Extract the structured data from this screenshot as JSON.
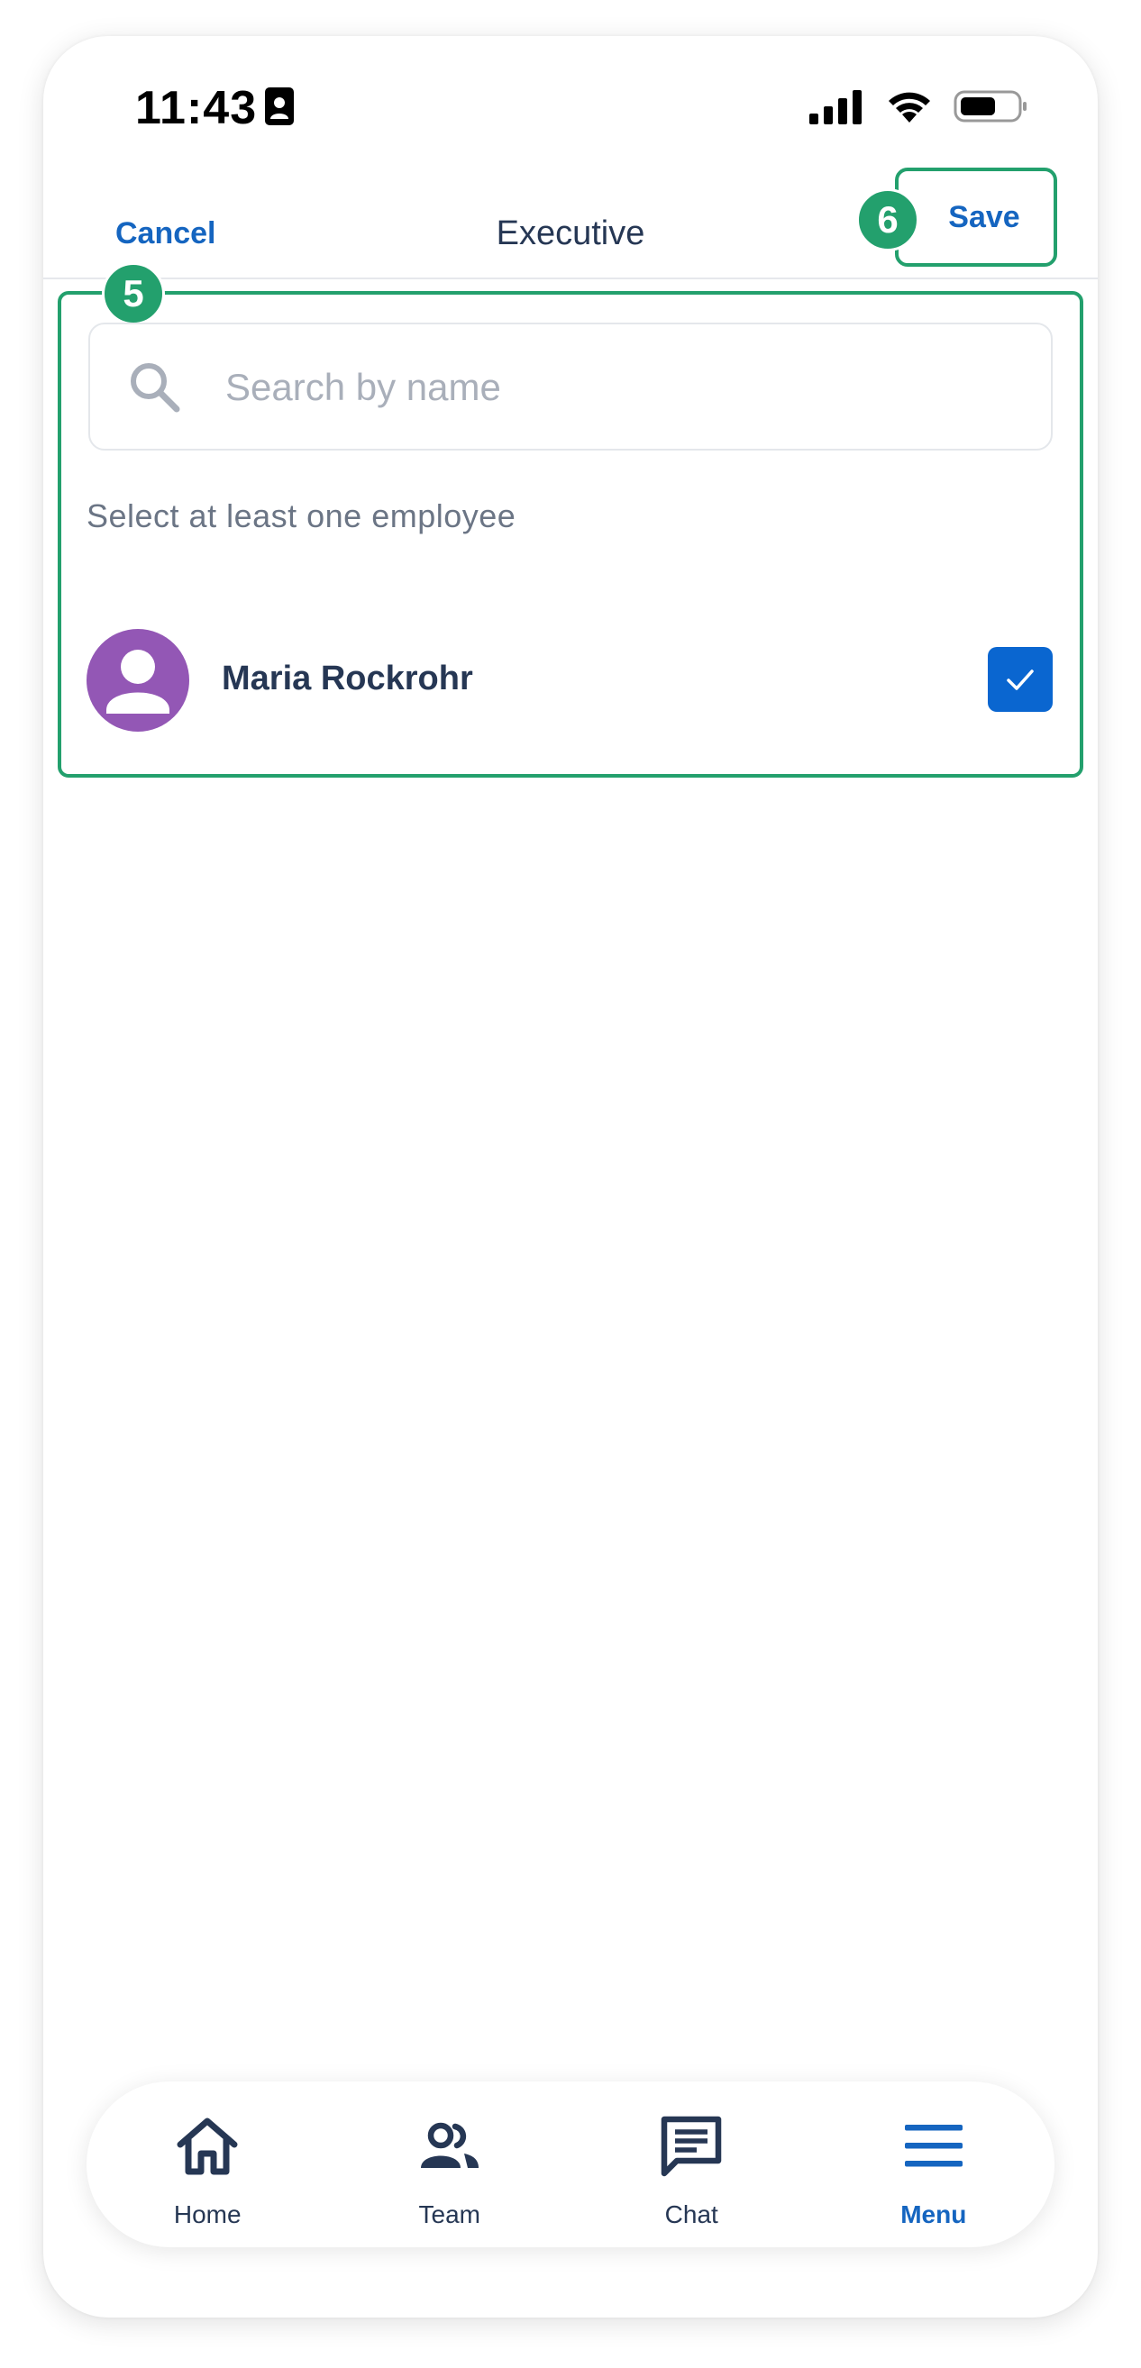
{
  "status_bar": {
    "time": "11:43"
  },
  "header": {
    "cancel_label": "Cancel",
    "title": "Executive",
    "save_label": "Save"
  },
  "annotations": {
    "panel_badge": "5",
    "save_badge": "6",
    "accent_color": "#23a06d"
  },
  "search": {
    "placeholder": "Search by name",
    "value": ""
  },
  "hint": "Select at least one employee",
  "employees": [
    {
      "name": "Maria Rockrohr",
      "avatar_color": "#9357b5",
      "selected": true
    }
  ],
  "tabbar": {
    "items": [
      {
        "label": "Home",
        "icon": "home-icon",
        "active": false
      },
      {
        "label": "Team",
        "icon": "team-icon",
        "active": false
      },
      {
        "label": "Chat",
        "icon": "chat-icon",
        "active": false
      },
      {
        "label": "Menu",
        "icon": "menu-icon",
        "active": true
      }
    ]
  },
  "colors": {
    "primary": "#1565c0",
    "text": "#263754",
    "checkbox": "#0a66d0"
  }
}
